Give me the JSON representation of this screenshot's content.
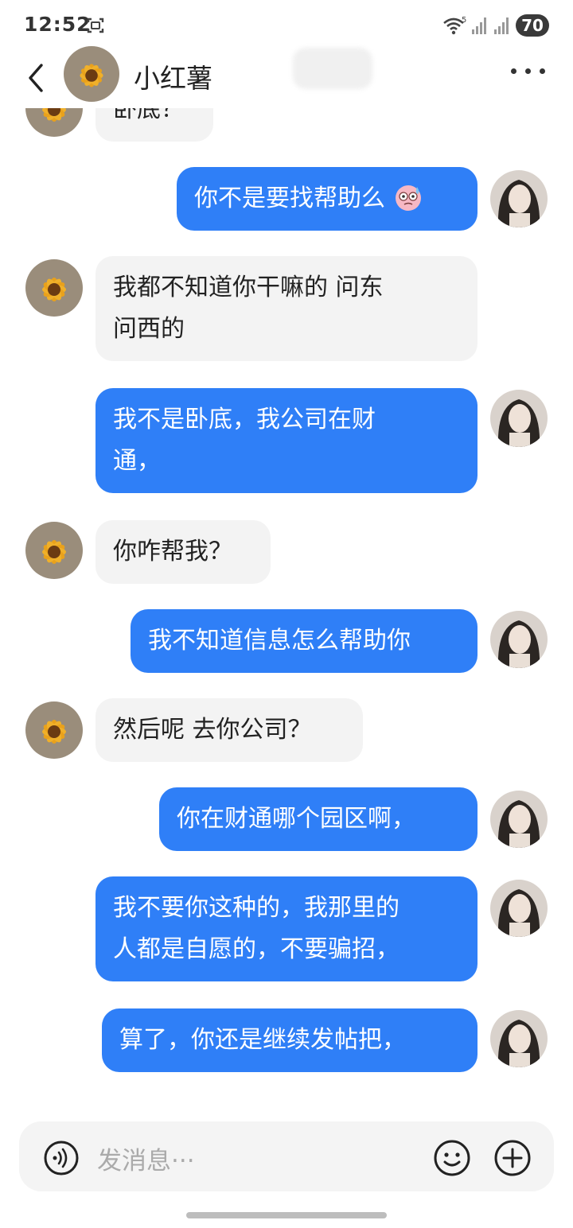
{
  "status_bar": {
    "time": "12:52",
    "battery": "70",
    "wifi_label": "5"
  },
  "header": {
    "contact_name": "小红薯"
  },
  "input": {
    "placeholder": "发消息···"
  },
  "messages": [
    {
      "side": "in",
      "text": "卧底？"
    },
    {
      "side": "out",
      "text": "你不是要找帮助么",
      "emoji": "sweat-face"
    },
    {
      "side": "in",
      "lines": [
        "我都不知道你干嘛的 问东",
        "问西的"
      ]
    },
    {
      "side": "out",
      "lines": [
        "我不是卧底，我公司在财",
        "通，"
      ]
    },
    {
      "side": "in",
      "text": "你咋帮我？"
    },
    {
      "side": "out",
      "text": "我不知道信息怎么帮助你"
    },
    {
      "side": "in",
      "text": "然后呢 去你公司？"
    },
    {
      "side": "out",
      "text": "你在财通哪个园区啊，"
    },
    {
      "side": "out",
      "lines": [
        "我不要你这种的，我那里的",
        "人都是自愿的，不要骗招，"
      ]
    },
    {
      "side": "out",
      "text": "算了，你还是继续发帖把，"
    }
  ],
  "colors": {
    "outgoing_bubble": "#2f7ff7",
    "incoming_bubble": "#f3f3f3"
  }
}
